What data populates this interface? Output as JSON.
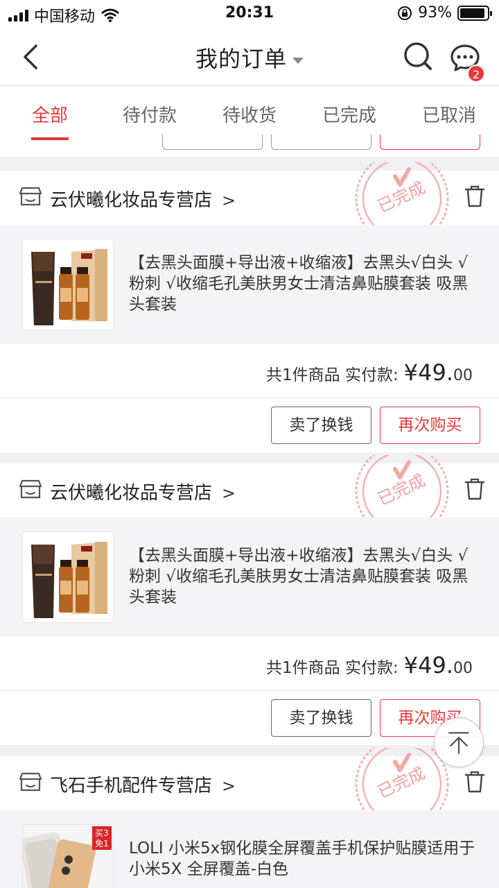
{
  "status_bar": {
    "carrier": "中国移动",
    "time": "20:31",
    "battery_percent": "93%",
    "battery_level": 0.93
  },
  "nav": {
    "title": "我的订单",
    "message_badge": "2"
  },
  "tabs": [
    {
      "label": "全部",
      "active": true
    },
    {
      "label": "待付款",
      "active": false
    },
    {
      "label": "待收货",
      "active": false
    },
    {
      "label": "已完成",
      "active": false
    },
    {
      "label": "已取消",
      "active": false
    }
  ],
  "orders": [
    {
      "shop": "云伏曦化妆品专营店",
      "stamp": "已完成",
      "title": "【去黑头面膜+导出液+收缩液】去黑头√白头 √粉刺 √收缩毛孔美肤男女士清洁鼻贴膜套装 吸黑头套装",
      "summary_label": "共1件商品  实付款:",
      "price_main": "¥49.",
      "price_cents": "00",
      "btn_sell": "卖了换钱",
      "btn_rebuy": "再次购买"
    },
    {
      "shop": "云伏曦化妆品专营店",
      "stamp": "已完成",
      "title": "【去黑头面膜+导出液+收缩液】去黑头√白头 √粉刺 √收缩毛孔美肤男女士清洁鼻贴膜套装 吸黑头套装",
      "summary_label": "共1件商品  实付款:",
      "price_main": "¥49.",
      "price_cents": "00",
      "btn_sell": "卖了换钱",
      "btn_rebuy": "再次购买"
    },
    {
      "shop": "飞石手机配件专营店",
      "stamp": "已完成",
      "title": "LOLI 小米5x钢化膜全屏覆盖手机保护贴膜适用于小米5X 全屏覆盖-白色",
      "thumb_badge_top": "买3",
      "thumb_badge_bottom": "免1"
    }
  ],
  "colors": {
    "accent": "#e4393c",
    "background": "#f0f0f2"
  }
}
